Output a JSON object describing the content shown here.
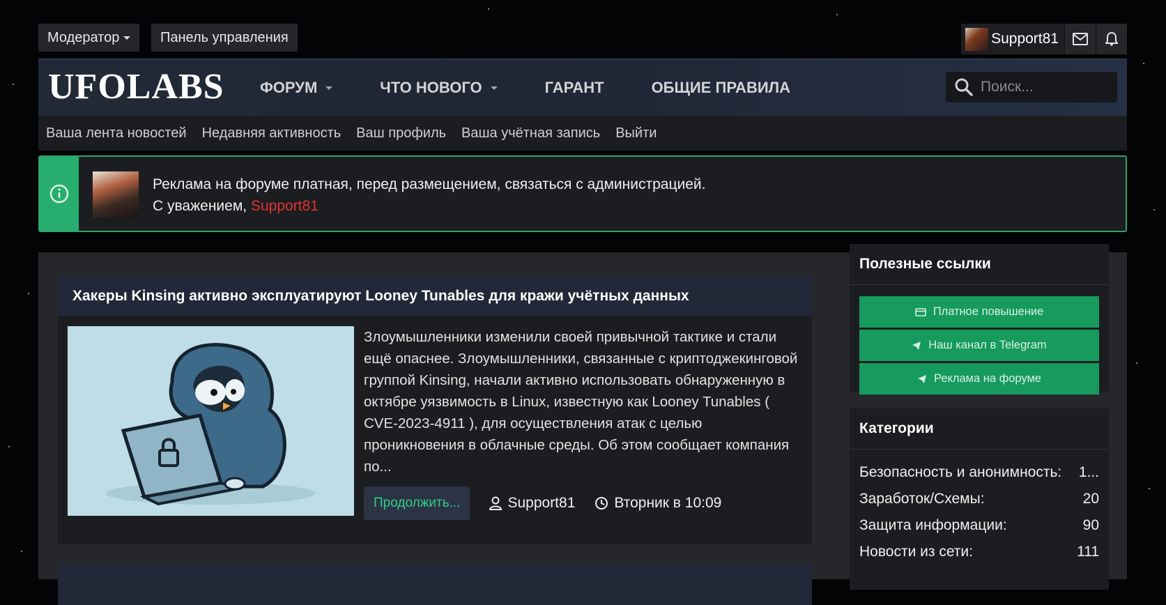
{
  "topbar": {
    "moderator_label": "Модератор",
    "control_panel_label": "Панель управления",
    "username": "Support81"
  },
  "header": {
    "logo": "UFOLABS",
    "nav": [
      {
        "label": "ФОРУМ",
        "has_dropdown": true
      },
      {
        "label": "ЧТО НОВОГО",
        "has_dropdown": true
      },
      {
        "label": "ГАРАНТ",
        "has_dropdown": false
      },
      {
        "label": "ОБЩИЕ ПРАВИЛА",
        "has_dropdown": false
      }
    ],
    "search_placeholder": "Поиск..."
  },
  "subnav": [
    "Ваша лента новостей",
    "Недавняя активность",
    "Ваш профиль",
    "Ваша учётная запись",
    "Выйти"
  ],
  "notice": {
    "line1": "Реклама на форуме платная, перед размещением, связаться с администрацией.",
    "line2_prefix": "С уважением, ",
    "line2_name": "Support81"
  },
  "article": {
    "title": "Хакеры Kinsing активно эксплуатируют Looney Tunables для кражи учётных данных",
    "excerpt": "Злоумышленники изменили своей привычной тактике и стали ещё опаснее. Злоумышленники, связанные с криптоджекинговой группой Kinsing, начали активно использовать обнаруженную в октябре уязвимость в Linux, известную как Looney Tunables ( CVE-2023-4911 ), для осуществления атак с целью проникновения в облачные среды. Об этом сообщает компания по...",
    "continue_label": "Продолжить...",
    "author": "Support81",
    "time": "Вторник в 10:09"
  },
  "sidebar": {
    "useful_links_title": "Полезные ссылки",
    "links": [
      "Платное повышение",
      "Наш канал в Telegram",
      "Реклама на форуме"
    ],
    "categories_title": "Категории",
    "categories": [
      {
        "name": "Безопасность и анонимность:",
        "count": "1..."
      },
      {
        "name": "Заработок/Схемы:",
        "count": "20"
      },
      {
        "name": "Защита информации:",
        "count": "90"
      },
      {
        "name": "Новости из сети:",
        "count": "111"
      }
    ]
  },
  "colors": {
    "accent_green": "#27ae6e",
    "button_green": "#179a5e",
    "highlight_red": "#e03434",
    "link_green": "#2ecf86"
  }
}
